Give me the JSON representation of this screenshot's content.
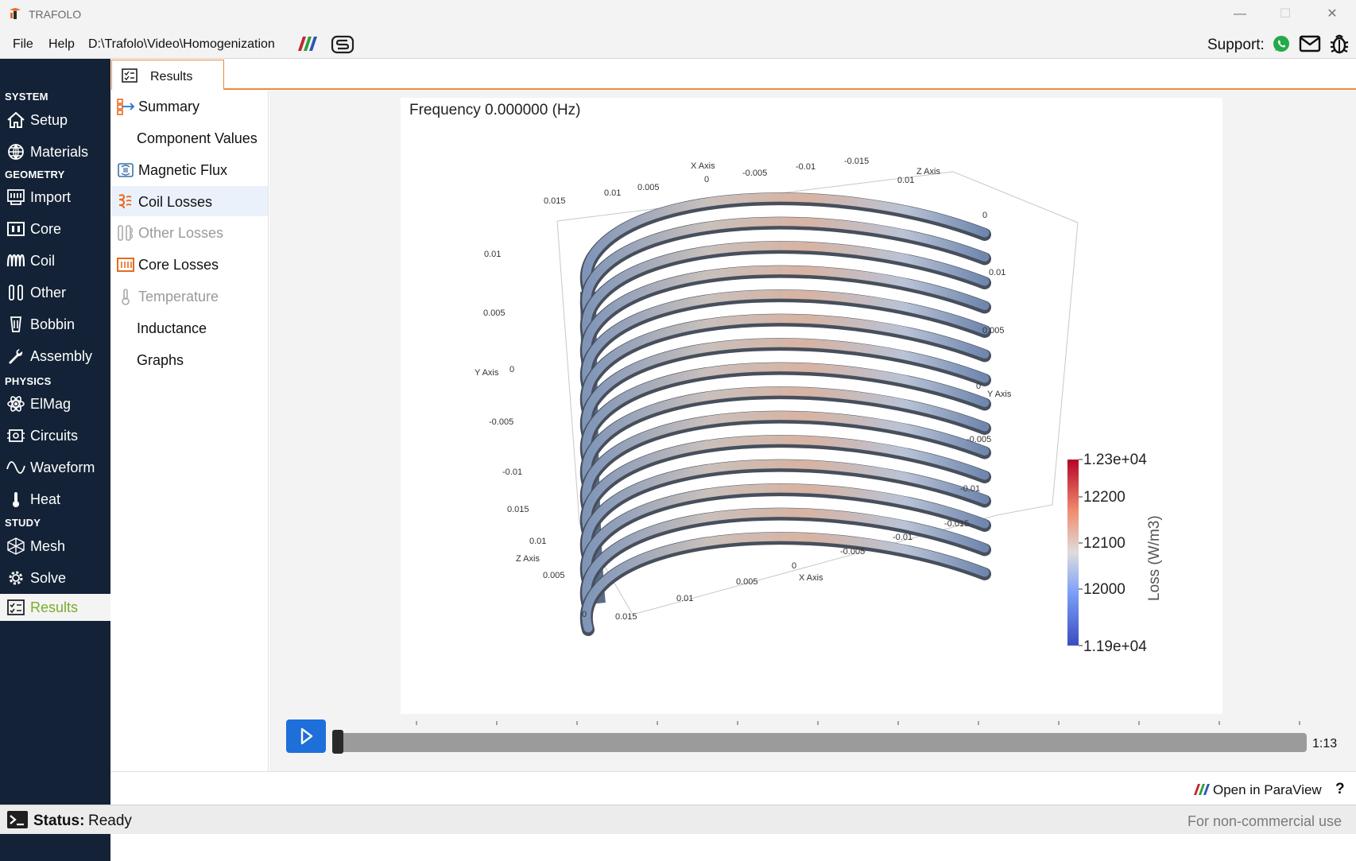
{
  "window": {
    "title": "TRAFOLO",
    "minimize": "—",
    "maximize": "☐",
    "close": "✕"
  },
  "menu": {
    "file": "File",
    "help": "Help",
    "project_path": "D:\\Trafolo\\Video\\Homogenization",
    "support_label": "Support:"
  },
  "nav": {
    "sections": {
      "system": "SYSTEM",
      "geometry": "GEOMETRY",
      "physics": "PHYSICS",
      "study": "STUDY"
    },
    "items": [
      {
        "label": "Setup",
        "icon": "home-icon"
      },
      {
        "label": "Materials",
        "icon": "globe-icon"
      },
      {
        "label": "Import",
        "icon": "import-icon"
      },
      {
        "label": "Core",
        "icon": "core-icon"
      },
      {
        "label": "Coil",
        "icon": "coil-icon"
      },
      {
        "label": "Other",
        "icon": "other-icon"
      },
      {
        "label": "Bobbin",
        "icon": "bobbin-icon"
      },
      {
        "label": "Assembly",
        "icon": "wrench-icon"
      },
      {
        "label": "ElMag",
        "icon": "atom-icon"
      },
      {
        "label": "Circuits",
        "icon": "circuit-icon"
      },
      {
        "label": "Waveform",
        "icon": "wave-icon"
      },
      {
        "label": "Heat",
        "icon": "thermometer-icon"
      },
      {
        "label": "Mesh",
        "icon": "mesh-icon"
      },
      {
        "label": "Solve",
        "icon": "gear-icon"
      },
      {
        "label": "Results",
        "icon": "results-icon"
      }
    ],
    "active": "Results"
  },
  "results_tab": {
    "label": "Results"
  },
  "result_items": [
    {
      "label": "Summary",
      "enabled": true
    },
    {
      "label": "Component Values",
      "enabled": true
    },
    {
      "label": "Magnetic Flux",
      "enabled": true
    },
    {
      "label": "Coil Losses",
      "enabled": true,
      "selected": true
    },
    {
      "label": "Other Losses",
      "enabled": false
    },
    {
      "label": "Core Losses",
      "enabled": true
    },
    {
      "label": "Temperature",
      "enabled": false
    },
    {
      "label": "Inductance",
      "enabled": true
    },
    {
      "label": "Graphs",
      "enabled": true
    }
  ],
  "viewer": {
    "frequency_label": "Frequency 0.000000 (Hz)",
    "axes": {
      "x_axis_label": "X Axis",
      "y_axis_label": "Y Axis",
      "z_axis_label": "Z Axis",
      "top_x_ticks": [
        "0.015",
        "0.01",
        "0.005",
        "0",
        "-0.005",
        "-0.01",
        "-0.015"
      ],
      "top_z_ticks": [
        "0.01",
        "0"
      ],
      "left_y_ticks": [
        "0.01",
        "0.005",
        "0",
        "-0.005",
        "-0.01"
      ],
      "right_y_ticks": [
        "0.01",
        "0.005",
        "0",
        "-0.005",
        "-0.01",
        "-0.015"
      ],
      "bottom_x_ticks": [
        "0.015",
        "0.01",
        "0.005",
        "0",
        "-0.005",
        "-0.01"
      ],
      "bottom_z_ticks": [
        "0.015",
        "0.01",
        "0.005",
        "0"
      ]
    },
    "colorbar": {
      "title": "Loss (W/m3)",
      "max_label": "1.23e+04",
      "ticks": [
        "12200",
        "12100",
        "12000"
      ],
      "min_label": "1.19e+04",
      "colors": [
        "#b40426",
        "#f18d6f",
        "#dddddd",
        "#7b9ff9",
        "#3b4cc0"
      ]
    }
  },
  "playback": {
    "progress": 0.0,
    "time_label": "1:13",
    "play_icon": "play-icon"
  },
  "bottom": {
    "open_paraview": "Open in ParaView",
    "help": "?"
  },
  "status": {
    "key": "Status:",
    "value": "Ready",
    "license_note": "For non-commercial use"
  }
}
